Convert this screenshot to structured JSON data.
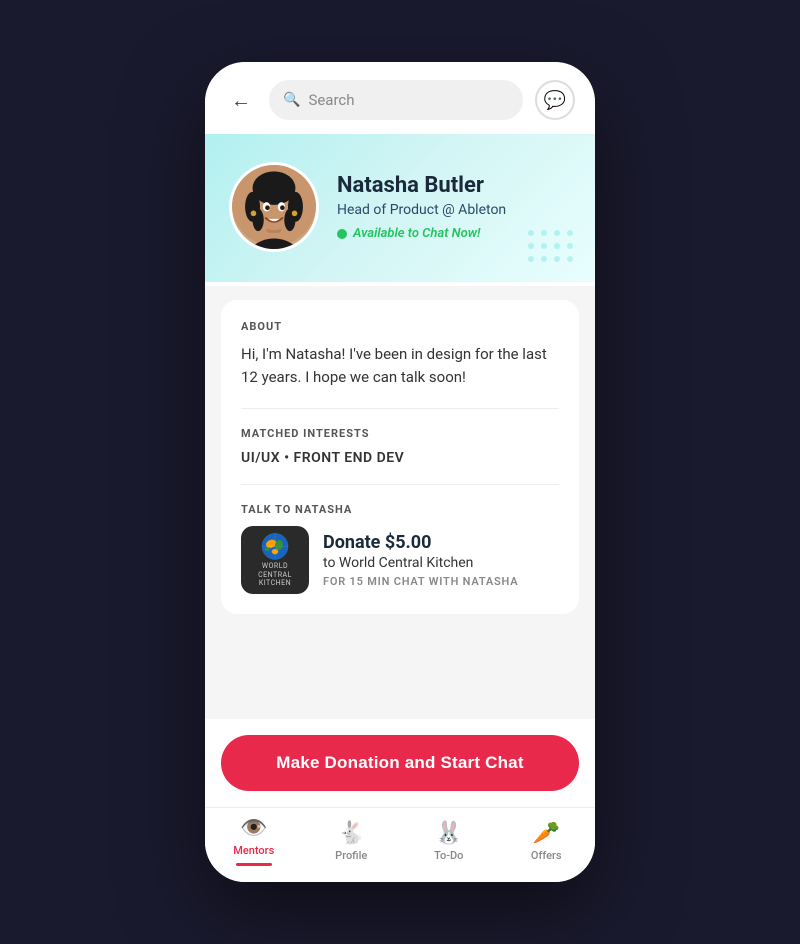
{
  "header": {
    "search_placeholder": "Search",
    "back_label": "Back"
  },
  "profile": {
    "name": "Natasha Butler",
    "title": "Head of Product @ Ableton",
    "availability": "Available to Chat Now!",
    "about_label": "ABOUT",
    "about_text": "Hi, I'm Natasha! I've been in design for the last 12 years. I hope we can talk soon!",
    "interests_label": "MATCHED INTERESTS",
    "interests_text": "UI/UX • FRONT END DEV",
    "talk_label": "TALK TO NATASHA",
    "donate_amount": "Donate $5.00",
    "donate_org": "to World Central Kitchen",
    "donate_detail": "FOR 15 MIN CHAT WITH NATASHA",
    "charity_name": "WORLD\nCENTRAL\nKITCHEN"
  },
  "cta": {
    "label": "Make Donation and Start Chat"
  },
  "nav": {
    "items": [
      {
        "id": "mentors",
        "label": "Mentors",
        "active": true
      },
      {
        "id": "profile",
        "label": "Profile",
        "active": false
      },
      {
        "id": "todo",
        "label": "To-Do",
        "active": false
      },
      {
        "id": "offers",
        "label": "Offers",
        "active": false
      }
    ]
  },
  "colors": {
    "accent": "#e8294c",
    "available": "#22c55e"
  }
}
